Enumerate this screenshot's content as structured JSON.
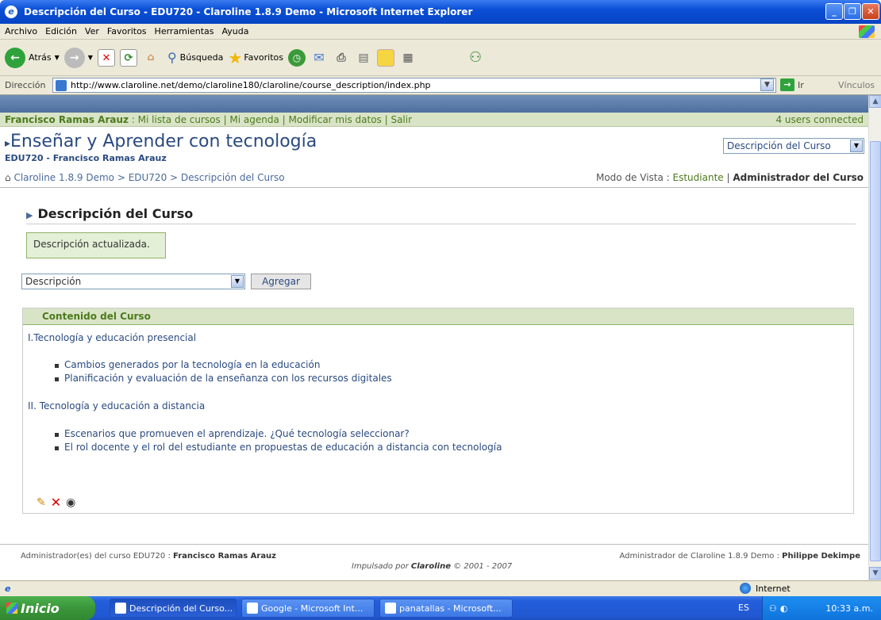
{
  "window": {
    "title": "Descripción del Curso - EDU720 - Claroline 1.8.9 Demo - Microsoft Internet Explorer"
  },
  "menu": [
    "Archivo",
    "Edición",
    "Ver",
    "Favoritos",
    "Herramientas",
    "Ayuda"
  ],
  "toolbar": {
    "back_label": "Atrás",
    "search_label": "Búsqueda",
    "favorites_label": "Favoritos"
  },
  "address": {
    "label": "Dirección",
    "url": "http://www.claroline.net/demo/claroline180/claroline/course_description/index.php",
    "go_label": "Ir",
    "links_label": "Vínculos"
  },
  "userbar": {
    "user": "Francisco Ramas Arauz",
    "links": " : Mi lista de cursos | Mi agenda | Modificar mis datos | Salir",
    "connected": "4 users connected"
  },
  "course": {
    "title": "Enseñar y Aprender con tecnología",
    "subtitle": "EDU720 - Francisco Ramas Arauz",
    "tool_select": "Descripción del Curso"
  },
  "breadcrumb": "Claroline 1.8.9 Demo > EDU720 > Descripción del Curso",
  "viewmode": {
    "label": "Modo de Vista : ",
    "student": "Estudiante",
    "sep": " | ",
    "admin": "Administrador del Curso"
  },
  "section": {
    "title": "Descripción del Curso",
    "message": "Descripción actualizada.",
    "select_value": "Descripción",
    "add_button": "Agregar"
  },
  "content": {
    "header": "Contenido del Curso",
    "part1": "I.Tecnología y educación presencial",
    "part1_items": [
      "Cambios generados por la tecnología en la educación",
      "Planificación y evaluación de la enseñanza con los recursos digitales"
    ],
    "part2": "II. Tecnología y educación a distancia",
    "part2_items": [
      "Escenarios que promueven el aprendizaje. ¿Qué tecnología seleccionar?",
      "El rol docente y el rol del estudiante en propuestas de educación a distancia con tecnología"
    ]
  },
  "footer": {
    "left_label": "Administrador(es) del curso EDU720 : ",
    "left_name": "Francisco Ramas Arauz",
    "right_label": "Administrador de Claroline 1.8.9 Demo : ",
    "right_name": "Philippe Dekimpe",
    "center_pre": "Impulsado por ",
    "center_brand": "Claroline",
    "center_post": " © 2001 - 2007"
  },
  "status": {
    "zone": "Internet"
  },
  "taskbar": {
    "start": "Inicio",
    "tasks": [
      "Descripción del Curso...",
      "Google - Microsoft Int...",
      "panatallas - Microsoft..."
    ],
    "lang": "ES",
    "clock": "10:33 a.m."
  }
}
